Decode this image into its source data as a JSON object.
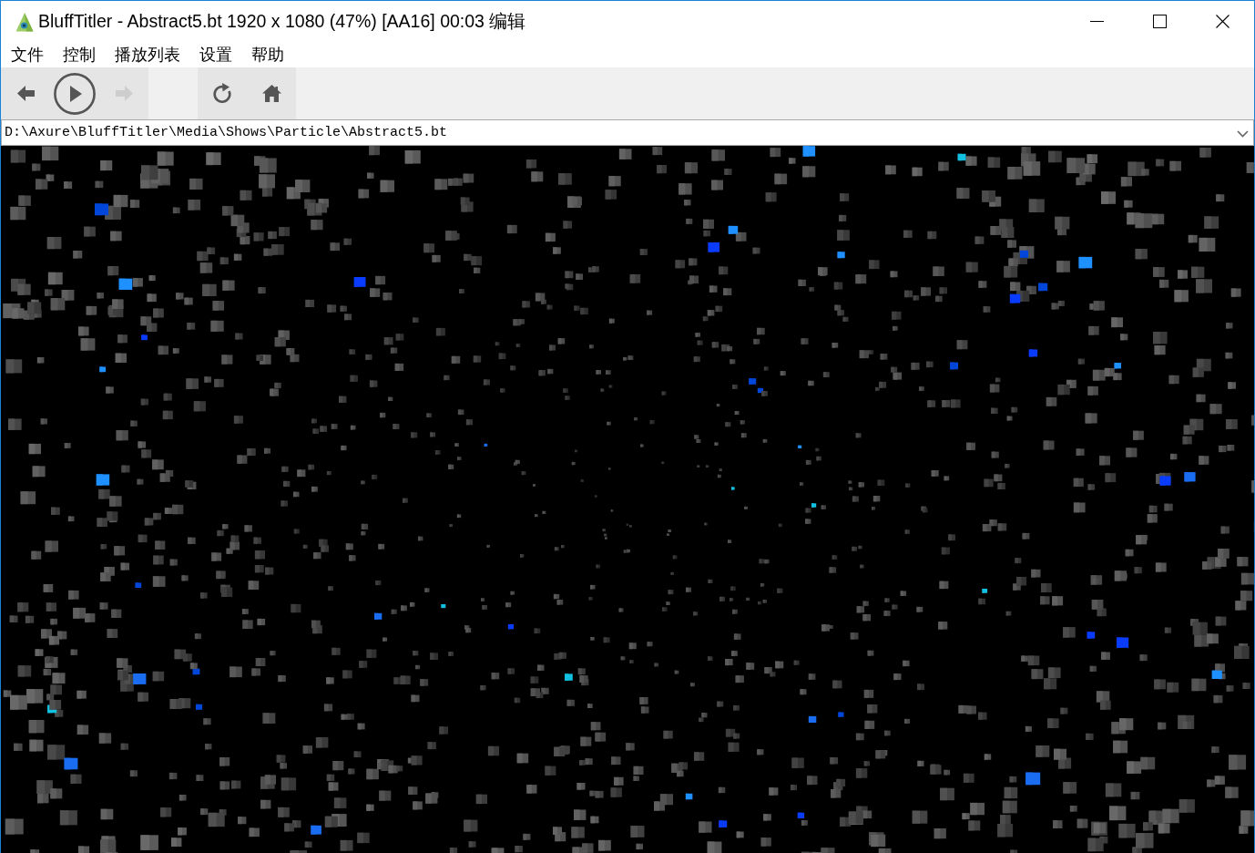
{
  "window": {
    "title": "BluffTitler - Abstract5.bt 1920 x 1080 (47%) [AA16] 00:03 编辑"
  },
  "menu_bar": [
    "文件",
    "控制",
    "播放列表",
    "设置",
    "帮助"
  ],
  "toolbar": {
    "groups": [
      {
        "buttons": [
          {
            "kind": "back",
            "disabled": false
          },
          {
            "kind": "play",
            "disabled": false
          },
          {
            "kind": "forward",
            "disabled": true
          }
        ]
      },
      {
        "buttons": [
          {
            "kind": "refresh",
            "disabled": false
          },
          {
            "kind": "home",
            "disabled": false
          }
        ]
      }
    ]
  },
  "address_bar": {
    "value": "D:\\Axure\\BluffTitler\\Media\\Shows\\Particle\\Abstract5.bt"
  }
}
